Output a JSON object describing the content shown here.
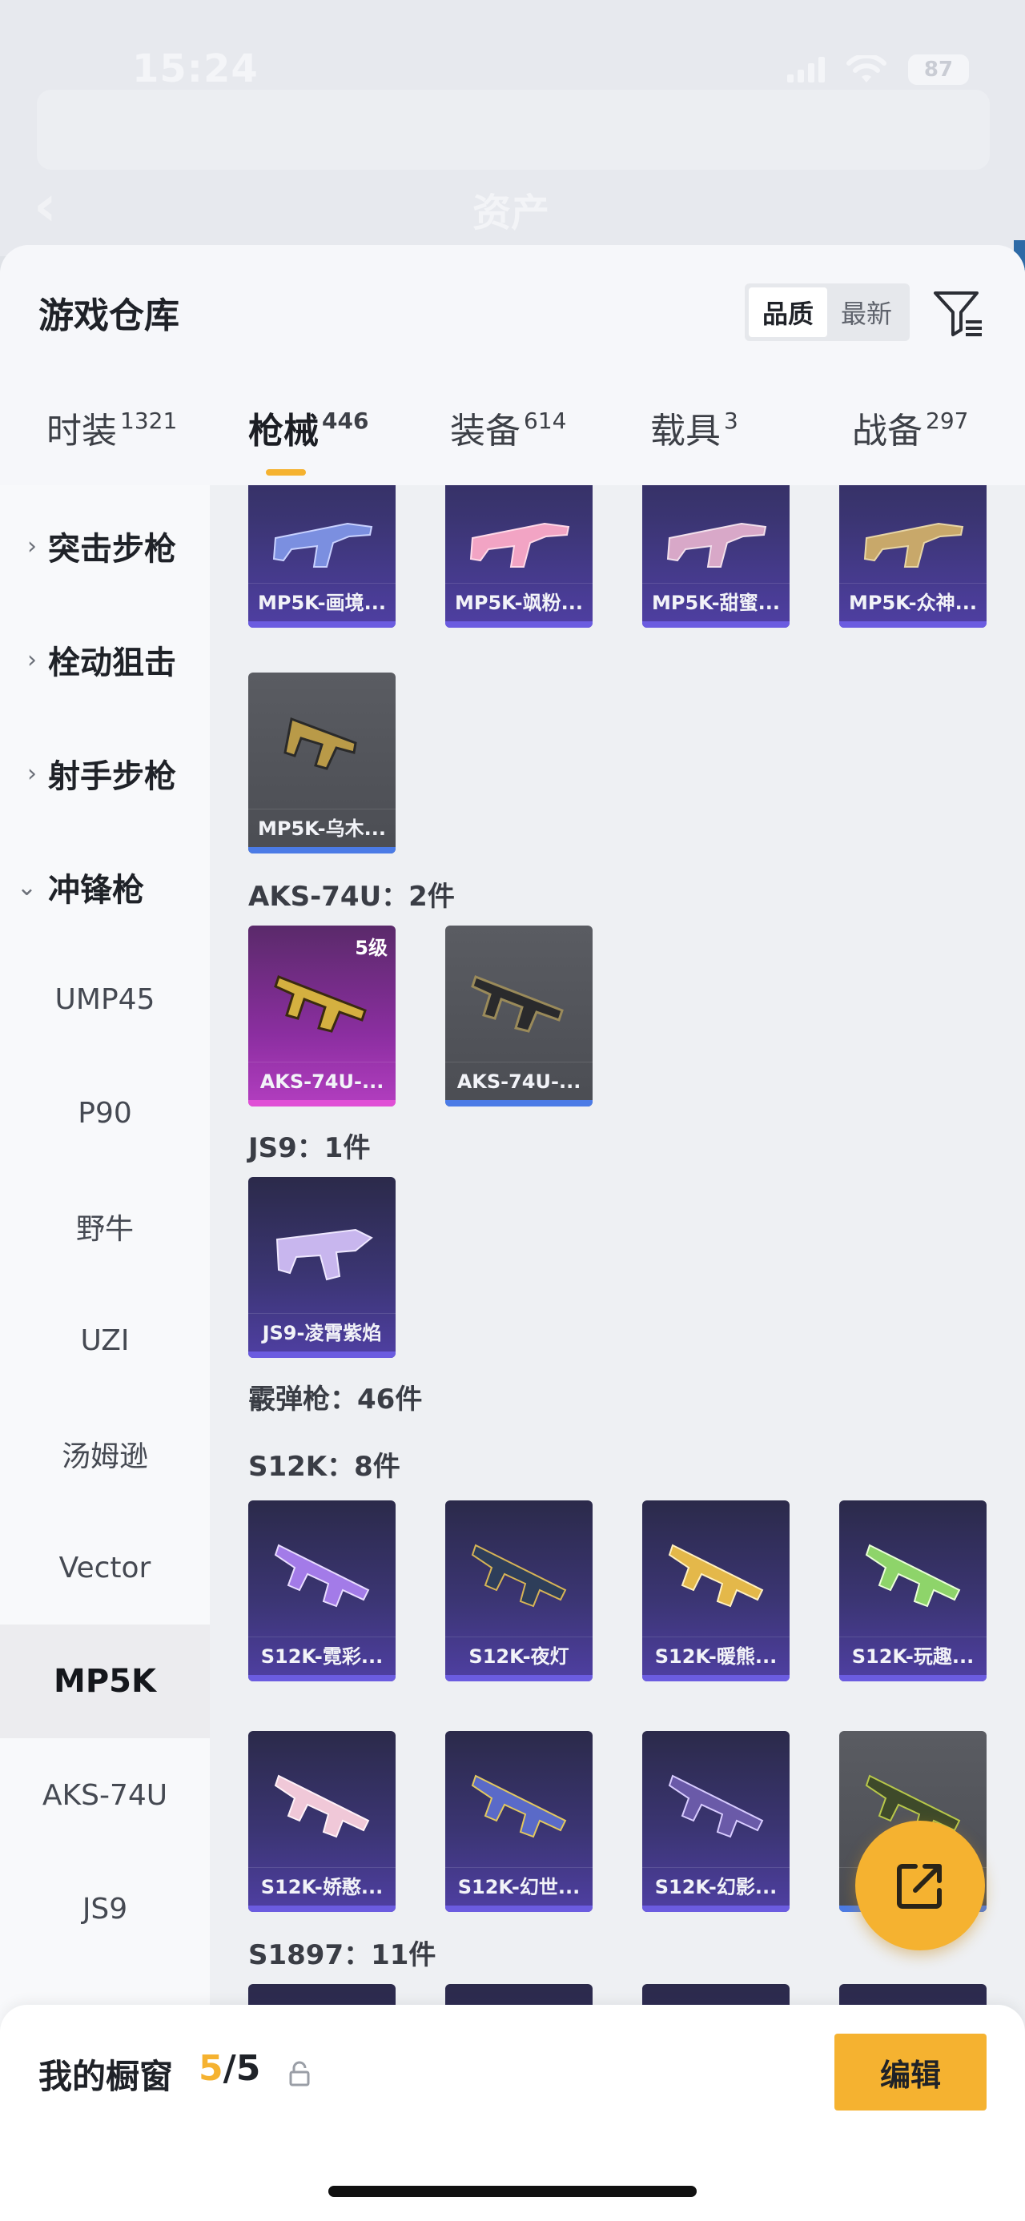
{
  "status_bar": {
    "time": "15:24",
    "battery": "87"
  },
  "background_page": {
    "title": "资产",
    "back": "‹"
  },
  "sheet": {
    "title": "游戏仓库",
    "sort": {
      "options": [
        "品质",
        "最新"
      ],
      "active": "品质"
    }
  },
  "tabs": [
    {
      "label": "时装",
      "count": "1321"
    },
    {
      "label": "枪械",
      "count": "446",
      "active": true
    },
    {
      "label": "装备",
      "count": "614"
    },
    {
      "label": "载具",
      "count": "3"
    },
    {
      "label": "战备",
      "count": "297"
    }
  ],
  "sidebar": {
    "categories": [
      {
        "label": "突击步枪",
        "chevron": "›"
      },
      {
        "label": "栓动狙击",
        "chevron": "›"
      },
      {
        "label": "射手步枪",
        "chevron": "›"
      },
      {
        "label": "冲锋枪",
        "chevron": "⌄"
      }
    ],
    "subitems": [
      "UMP45",
      "P90",
      "野牛",
      "UZI",
      "汤姆逊",
      "Vector",
      "MP5K",
      "AKS-74U",
      "JS9"
    ],
    "selected": "MP5K"
  },
  "content": {
    "mp5k_row1": [
      "MP5K-画境...",
      "MP5K-飒粉...",
      "MP5K-甜蜜...",
      "MP5K-众神..."
    ],
    "mp5k_row2": [
      "MP5K-乌木..."
    ],
    "aks_label": "AKS-74U：2件",
    "aks_items": [
      {
        "name": "AKS-74U-...",
        "level": "5级"
      },
      {
        "name": "AKS-74U-..."
      }
    ],
    "js9_label": "JS9：1件",
    "js9_items": [
      "JS9-凌霄紫焰"
    ],
    "shotgun_label": "霰弹枪：46件",
    "s12k_label": "S12K：8件",
    "s12k_row1": [
      "S12K-霓彩...",
      "S12K-夜灯",
      "S12K-暖熊...",
      "S12K-玩趣..."
    ],
    "s12k_row2": [
      "S12K-娇憨...",
      "S12K-幻世...",
      "S12K-幻影...",
      ""
    ],
    "s1897_label": "S1897：11件"
  },
  "bottom_bar": {
    "title": "我的橱窗",
    "count_current": "5",
    "count_total": "/5",
    "edit_label": "编辑"
  },
  "colors": {
    "accent": "#f5b230",
    "purple_quality": "#6b5ce0",
    "grey_quality": "#4b7be6",
    "pink_quality": "#e04fd6"
  },
  "icons": [
    "back-icon",
    "signal-icon",
    "wifi-icon",
    "battery-icon",
    "filter-icon",
    "chevron-right-icon",
    "chevron-down-icon",
    "lock-icon",
    "share-icon"
  ]
}
